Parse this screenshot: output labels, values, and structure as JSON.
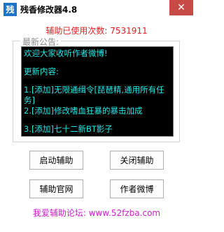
{
  "titlebar": {
    "icon_glyph": "残",
    "title": "残香修改器4.8",
    "close_glyph": "✕"
  },
  "usage": {
    "label": "辅助已使用次数: 7531911"
  },
  "notice": {
    "group_label": "最新公告:",
    "lines": [
      "欢迎大家收听作者微博!",
      "",
      "更新内容:",
      "",
      "1.[添加]无限通缉令[琵琶精,通用所有任务]",
      "2.[添加]修改嗜血狂暴的暴击加成",
      "",
      "3.[添加]七十二新BT影子"
    ]
  },
  "buttons": {
    "start": "启动辅助",
    "stop": "关闭辅助",
    "website": "辅助官网",
    "weibo": "作者微博"
  },
  "footer": {
    "text": "我爱辅助论坛: www.52fzba.com"
  },
  "colors": {
    "accent_red": "#e02020",
    "notice_text": "#20e8e8",
    "footer_magenta": "#cc22cc",
    "close_red": "#c74a45"
  }
}
